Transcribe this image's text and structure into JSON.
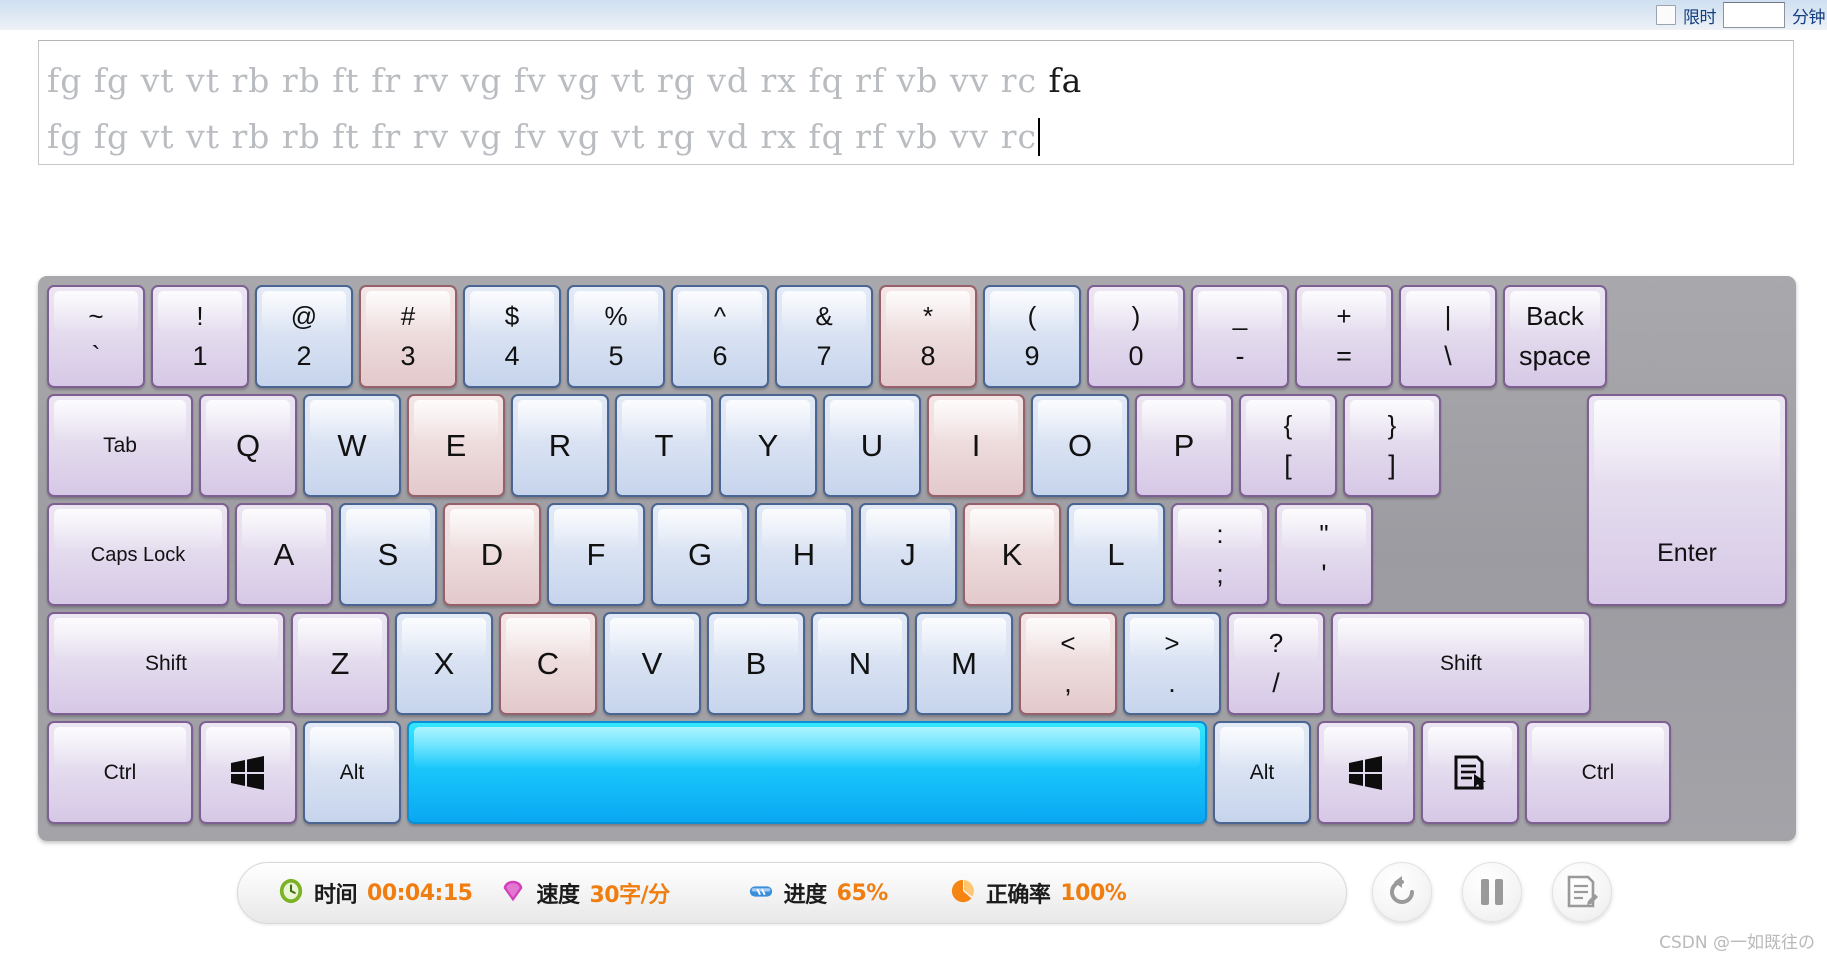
{
  "top_controls": {
    "limit_checkbox_label": "限时",
    "limit_minutes_value": "",
    "limit_minutes_unit": "分钟"
  },
  "text_panel": {
    "line1_typed": "fg fg vt vt rb rb ft fr rv vg fv vg vt rg vd rx fq rf vb vv rc ",
    "line1_upcoming": "fa",
    "line2_typed": "fg fg vt vt rb rb ft fr rv vg fv vg vt rg vd rx fq rf vb vv rc"
  },
  "keyboard": {
    "rows": [
      {
        "name": "number-row",
        "keys": [
          {
            "name": "key-backquote",
            "top": "~",
            "bottom": "`",
            "color": "purple",
            "type": "dual"
          },
          {
            "name": "key-1",
            "top": "!",
            "bottom": "1",
            "color": "purple",
            "type": "dual"
          },
          {
            "name": "key-2",
            "top": "@",
            "bottom": "2",
            "color": "blue",
            "type": "dual"
          },
          {
            "name": "key-3",
            "top": "#",
            "bottom": "3",
            "color": "pink",
            "type": "dual"
          },
          {
            "name": "key-4",
            "top": "$",
            "bottom": "4",
            "color": "blue",
            "type": "dual"
          },
          {
            "name": "key-5",
            "top": "%",
            "bottom": "5",
            "color": "blue",
            "type": "dual"
          },
          {
            "name": "key-6",
            "top": "^",
            "bottom": "6",
            "color": "blue",
            "type": "dual"
          },
          {
            "name": "key-7",
            "top": "&",
            "bottom": "7",
            "color": "blue",
            "type": "dual"
          },
          {
            "name": "key-8",
            "top": "*",
            "bottom": "8",
            "color": "pink",
            "type": "dual"
          },
          {
            "name": "key-9",
            "top": "(",
            "bottom": "9",
            "color": "blue",
            "type": "dual"
          },
          {
            "name": "key-0",
            "top": ")",
            "bottom": "0",
            "color": "purple",
            "type": "dual"
          },
          {
            "name": "key-minus",
            "top": "_",
            "bottom": "-",
            "color": "purple",
            "type": "dual"
          },
          {
            "name": "key-equals",
            "top": "+",
            "bottom": "=",
            "color": "purple",
            "type": "dual"
          },
          {
            "name": "key-backslash",
            "top": "|",
            "bottom": "\\",
            "color": "purple",
            "type": "dual"
          },
          {
            "name": "key-backspace",
            "top": "Back",
            "bottom": "space",
            "color": "purple",
            "type": "word-dual",
            "width": "w-backspace"
          }
        ]
      },
      {
        "name": "qwerty-row",
        "keys": [
          {
            "name": "key-tab",
            "top": "Tab",
            "color": "purple",
            "type": "word",
            "width": "w-tab"
          },
          {
            "name": "key-q",
            "top": "Q",
            "color": "purple",
            "type": "single"
          },
          {
            "name": "key-w",
            "top": "W",
            "color": "blue",
            "type": "single"
          },
          {
            "name": "key-e",
            "top": "E",
            "color": "pink",
            "type": "single"
          },
          {
            "name": "key-r",
            "top": "R",
            "color": "blue",
            "type": "single"
          },
          {
            "name": "key-t",
            "top": "T",
            "color": "blue",
            "type": "single"
          },
          {
            "name": "key-y",
            "top": "Y",
            "color": "blue",
            "type": "single"
          },
          {
            "name": "key-u",
            "top": "U",
            "color": "blue",
            "type": "single"
          },
          {
            "name": "key-i",
            "top": "I",
            "color": "pink",
            "type": "single"
          },
          {
            "name": "key-o",
            "top": "O",
            "color": "blue",
            "type": "single"
          },
          {
            "name": "key-p",
            "top": "P",
            "color": "purple",
            "type": "single"
          },
          {
            "name": "key-bracket-left",
            "top": "{",
            "bottom": "[",
            "color": "purple",
            "type": "dual"
          },
          {
            "name": "key-bracket-right",
            "top": "}",
            "bottom": "]",
            "color": "purple",
            "type": "dual"
          }
        ]
      },
      {
        "name": "home-row",
        "keys": [
          {
            "name": "key-caps-lock",
            "top": "Caps Lock",
            "color": "purple",
            "type": "word",
            "width": "w-caps"
          },
          {
            "name": "key-a",
            "top": "A",
            "color": "purple",
            "type": "single"
          },
          {
            "name": "key-s",
            "top": "S",
            "color": "blue",
            "type": "single"
          },
          {
            "name": "key-d",
            "top": "D",
            "color": "pink",
            "type": "single"
          },
          {
            "name": "key-f",
            "top": "F",
            "color": "blue",
            "type": "single"
          },
          {
            "name": "key-g",
            "top": "G",
            "color": "blue",
            "type": "single"
          },
          {
            "name": "key-h",
            "top": "H",
            "color": "blue",
            "type": "single"
          },
          {
            "name": "key-j",
            "top": "J",
            "color": "blue",
            "type": "single"
          },
          {
            "name": "key-k",
            "top": "K",
            "color": "pink",
            "type": "single"
          },
          {
            "name": "key-l",
            "top": "L",
            "color": "blue",
            "type": "single"
          },
          {
            "name": "key-semicolon",
            "top": ":",
            "bottom": ";",
            "color": "purple",
            "type": "dual"
          },
          {
            "name": "key-quote",
            "top": "\"",
            "bottom": "'",
            "color": "purple",
            "type": "dual"
          }
        ]
      },
      {
        "name": "zxcv-row",
        "keys": [
          {
            "name": "key-shift-left",
            "top": "Shift",
            "color": "purple",
            "type": "word",
            "width": "w-lshift"
          },
          {
            "name": "key-z",
            "top": "Z",
            "color": "purple",
            "type": "single"
          },
          {
            "name": "key-x",
            "top": "X",
            "color": "blue",
            "type": "single"
          },
          {
            "name": "key-c",
            "top": "C",
            "color": "pink",
            "type": "single"
          },
          {
            "name": "key-v",
            "top": "V",
            "color": "blue",
            "type": "single"
          },
          {
            "name": "key-b",
            "top": "B",
            "color": "blue",
            "type": "single"
          },
          {
            "name": "key-n",
            "top": "N",
            "color": "blue",
            "type": "single"
          },
          {
            "name": "key-m",
            "top": "M",
            "color": "blue",
            "type": "single"
          },
          {
            "name": "key-comma",
            "top": "<",
            "bottom": ",",
            "color": "pink",
            "type": "dual"
          },
          {
            "name": "key-period",
            "top": ">",
            "bottom": ".",
            "color": "blue",
            "type": "dual"
          },
          {
            "name": "key-slash",
            "top": "?",
            "bottom": "/",
            "color": "purple",
            "type": "dual"
          },
          {
            "name": "key-shift-right",
            "top": "Shift",
            "color": "purple",
            "type": "word",
            "width": "w-rshift"
          }
        ]
      },
      {
        "name": "bottom-row",
        "keys": [
          {
            "name": "key-ctrl-left",
            "top": "Ctrl",
            "color": "purple",
            "type": "word",
            "width": "w-ctrl"
          },
          {
            "name": "key-win-left",
            "icon": "windows-logo-icon",
            "color": "purple",
            "type": "icon"
          },
          {
            "name": "key-alt-left",
            "top": "Alt",
            "color": "blue",
            "type": "word"
          },
          {
            "name": "key-space",
            "color": "active",
            "type": "blank",
            "width": "w-space"
          },
          {
            "name": "key-alt-right",
            "top": "Alt",
            "color": "blue",
            "type": "word"
          },
          {
            "name": "key-win-right",
            "icon": "windows-logo-icon",
            "color": "purple",
            "type": "icon"
          },
          {
            "name": "key-menu",
            "icon": "context-menu-icon",
            "color": "purple",
            "type": "icon"
          },
          {
            "name": "key-ctrl-right",
            "top": "Ctrl",
            "color": "purple",
            "type": "word",
            "width": "w-ctrl"
          }
        ]
      }
    ],
    "enter_key": {
      "name": "key-enter",
      "label": "Enter",
      "color": "purple"
    }
  },
  "status_bar": {
    "stats": [
      {
        "name": "time",
        "icon": "clock-icon",
        "icon_color": "#7cb326",
        "label": "时间",
        "value": "00:04:15"
      },
      {
        "name": "speed",
        "icon": "speed-icon",
        "icon_color": "#d33fbb",
        "label": "速度",
        "value": "30字/分"
      },
      {
        "name": "progress",
        "icon": "progress-icon",
        "icon_color": "#3a8fdb",
        "label": "进度",
        "value": "65%"
      },
      {
        "name": "accuracy",
        "icon": "accuracy-icon",
        "icon_color": "#f58411",
        "label": "正确率",
        "value": "100%"
      }
    ]
  },
  "action_buttons": [
    {
      "name": "restart-button",
      "icon": "restart-icon"
    },
    {
      "name": "pause-button",
      "icon": "pause-icon"
    },
    {
      "name": "report-button",
      "icon": "report-icon"
    }
  ],
  "watermark": {
    "text": "CSDN @一如既往の"
  },
  "colors": {
    "accent_orange": "#f07d10",
    "key_purple": "#d6c8e6",
    "key_blue": "#c6d4ec",
    "key_pink": "#e3c9cb",
    "key_active": "#19c7fb",
    "keyboard_frame": "#9b9ba1"
  }
}
